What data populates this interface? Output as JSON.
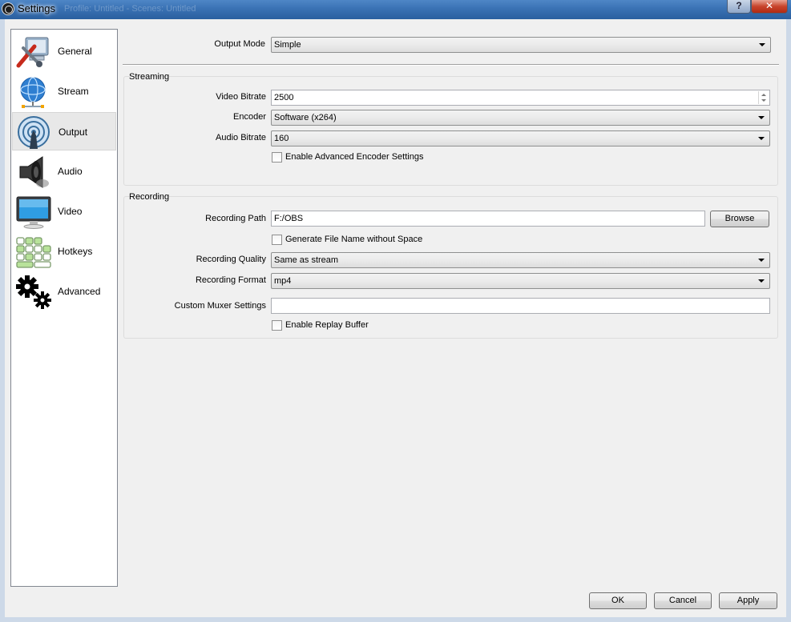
{
  "window": {
    "title": "Settings",
    "help_glyph": "?",
    "close_glyph": "✕",
    "ghost_title": "Profile: Untitled - Scenes: Untitled"
  },
  "sidebar": {
    "items": [
      {
        "label": "General",
        "icon": "general-icon"
      },
      {
        "label": "Stream",
        "icon": "stream-icon"
      },
      {
        "label": "Output",
        "icon": "output-icon",
        "selected": true
      },
      {
        "label": "Audio",
        "icon": "audio-icon"
      },
      {
        "label": "Video",
        "icon": "video-icon"
      },
      {
        "label": "Hotkeys",
        "icon": "hotkeys-icon"
      },
      {
        "label": "Advanced",
        "icon": "advanced-icon"
      }
    ]
  },
  "output": {
    "mode_label": "Output Mode",
    "mode_value": "Simple"
  },
  "streaming": {
    "title": "Streaming",
    "video_bitrate_label": "Video Bitrate",
    "video_bitrate_value": "2500",
    "encoder_label": "Encoder",
    "encoder_value": "Software (x264)",
    "audio_bitrate_label": "Audio Bitrate",
    "audio_bitrate_value": "160",
    "advanced_encoder_label": "Enable Advanced Encoder Settings",
    "advanced_encoder_checked": false
  },
  "recording": {
    "title": "Recording",
    "path_label": "Recording Path",
    "path_value": "F:/OBS",
    "browse_label": "Browse",
    "nospace_label": "Generate File Name without Space",
    "nospace_checked": false,
    "quality_label": "Recording Quality",
    "quality_value": "Same as stream",
    "format_label": "Recording Format",
    "format_value": "mp4",
    "muxer_label": "Custom Muxer Settings",
    "muxer_value": "",
    "replay_label": "Enable Replay Buffer",
    "replay_checked": false
  },
  "footer": {
    "ok_label": "OK",
    "cancel_label": "Cancel",
    "apply_label": "Apply"
  }
}
